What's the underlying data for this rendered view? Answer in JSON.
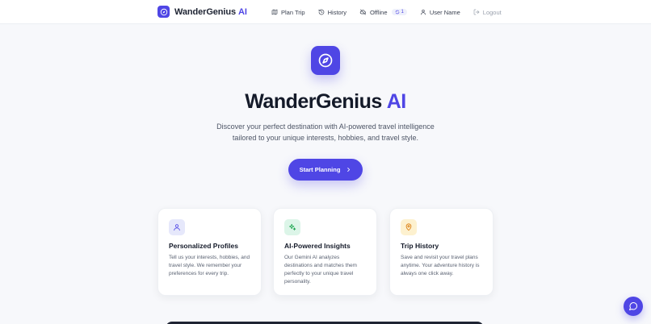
{
  "colors": {
    "accent": "#4f46e5",
    "text_dark": "#141a29",
    "background": "#f7f8fb"
  },
  "header": {
    "brand_name": "WanderGenius",
    "brand_ai": "AI",
    "brand_icon": "compass-icon",
    "nav": [
      {
        "label": "Plan Trip",
        "icon": "map-icon"
      },
      {
        "label": "History",
        "icon": "history-icon"
      },
      {
        "label": "Offline",
        "icon": "cloud-off-icon",
        "badge": "1"
      },
      {
        "label": "User Name",
        "icon": "user-icon"
      },
      {
        "label": "Logout",
        "icon": "logout-icon"
      }
    ]
  },
  "hero": {
    "title_main": "WanderGenius",
    "title_ai": "AI",
    "subtitle": "Discover your perfect destination with AI-powered travel intelligence tailored to your unique interests, hobbies, and travel style.",
    "cta_label": "Start Planning"
  },
  "features": [
    {
      "title": "Personalized Profiles",
      "text": "Tell us your interests, hobbies, and travel style. We remember your preferences for every trip.",
      "icon": "user-icon"
    },
    {
      "title": "AI-Powered Insights",
      "text": "Our Gemini AI analyzes destinations and matches them perfectly to your unique travel personality.",
      "icon": "sparkles-icon"
    },
    {
      "title": "Trip History",
      "text": "Save and revisit your travel plans anytime. Your adventure history is always one click away.",
      "icon": "map-pin-icon"
    }
  ],
  "chat": {
    "icon": "chat-bubble-icon"
  }
}
